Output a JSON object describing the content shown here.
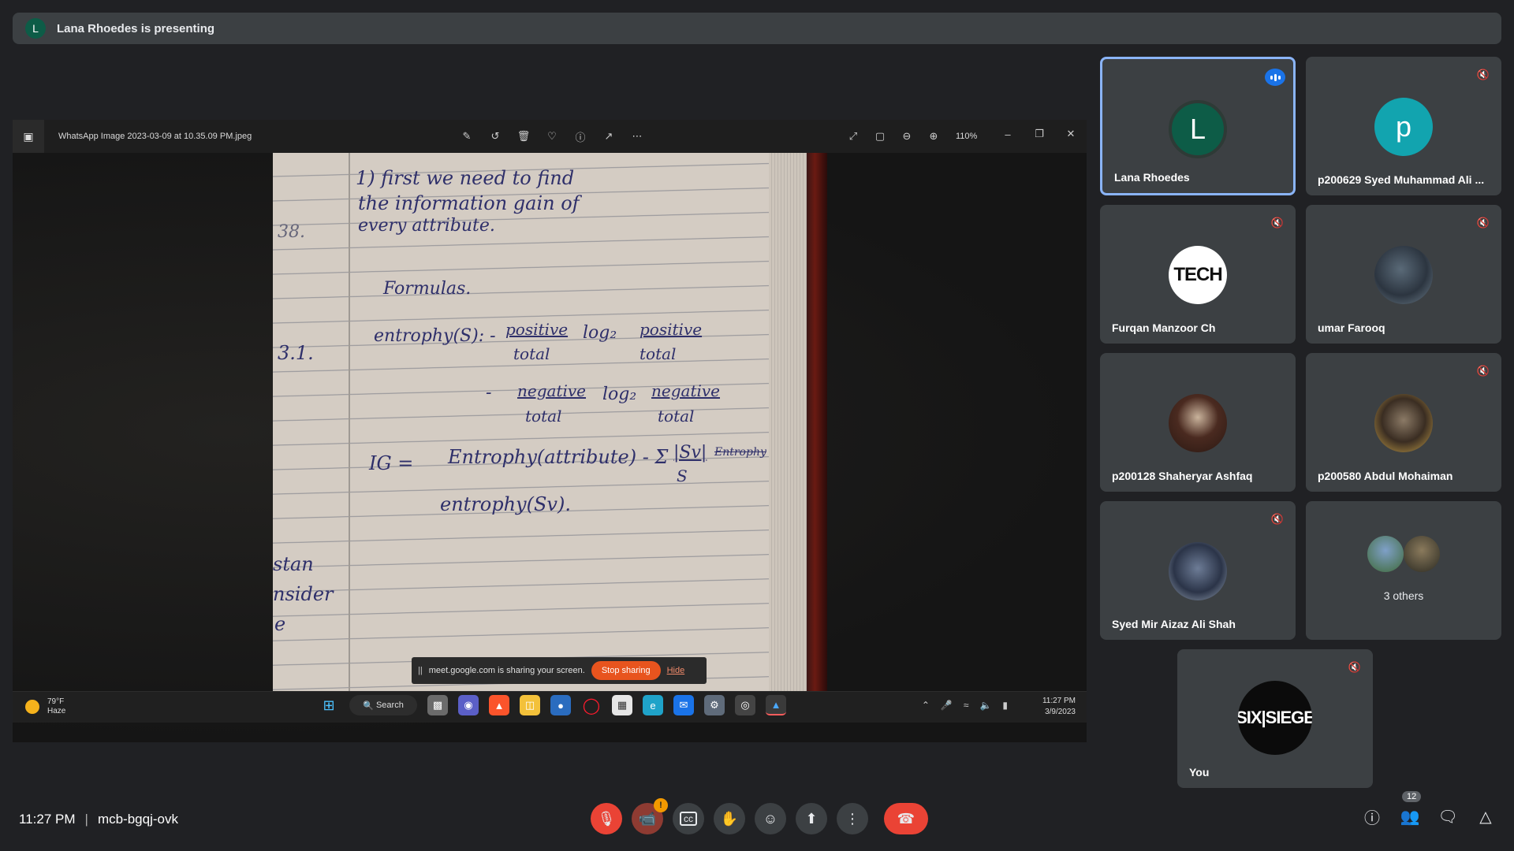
{
  "banner": {
    "avatar_letter": "L",
    "text": "Lana Rhoedes is presenting"
  },
  "shared_screen": {
    "photo_viewer": {
      "filename": "WhatsApp Image 2023-03-09 at 10.35.09 PM.jpeg",
      "zoom": "110%"
    },
    "notes": {
      "line1": "1) first   we  need  to  find",
      "line2": "the  information  gain  of",
      "line3": "every   attribute.",
      "margin1": "38.",
      "formulas": "Formulas.",
      "entropy_label": "entrophy(S): -",
      "pos1": "positive",
      "pos_log": "log₂",
      "pos2": "positive",
      "total1": "total",
      "total2": "total",
      "margin2": "3.1.",
      "neg_minus": "-",
      "neg1": "negative",
      "neg_log": "log₂",
      "neg2": "negative",
      "total3": "total",
      "total4": "total",
      "ig_label": "IG  =",
      "ig_formula": "Entrophy(attribute) - Σ",
      "sv": "|Sv|",
      "s": "S",
      "struck": "Entrophy",
      "entropy_sv": "entrophy(Sv).",
      "left_partial1": "stan",
      "left_partial2": "nsider",
      "left_partial3": "e"
    },
    "share_notice": {
      "pause": "||",
      "message": "meet.google.com is sharing your screen.",
      "stop": "Stop sharing",
      "hide": "Hide"
    },
    "taskbar": {
      "weather_temp": "79°F",
      "weather_desc": "Haze",
      "search": "Search",
      "time": "11:27 PM",
      "date": "3/9/2023"
    }
  },
  "participants": [
    {
      "name": "Lana Rhoedes",
      "initial": "L",
      "color": "#0d5c47"
    },
    {
      "name": "p200629 Syed Muhammad Ali ...",
      "initial": "p",
      "color": "#12a4af"
    },
    {
      "name": "Furqan Manzoor Ch",
      "initial": "TECH"
    },
    {
      "name": "umar Farooq"
    },
    {
      "name": "p200128 Shaheryar Ashfaq"
    },
    {
      "name": "p200580 Abdul Mohaiman"
    },
    {
      "name": "Syed Mir Aizaz Ali Shah"
    },
    {
      "name": "3 others"
    },
    {
      "name": "You",
      "initial": "SIX|SIEGE"
    }
  ],
  "bottom": {
    "time": "11:27 PM",
    "meeting_code": "mcb-bgqj-ovk",
    "people_count": "12",
    "camera_warning": "!"
  }
}
